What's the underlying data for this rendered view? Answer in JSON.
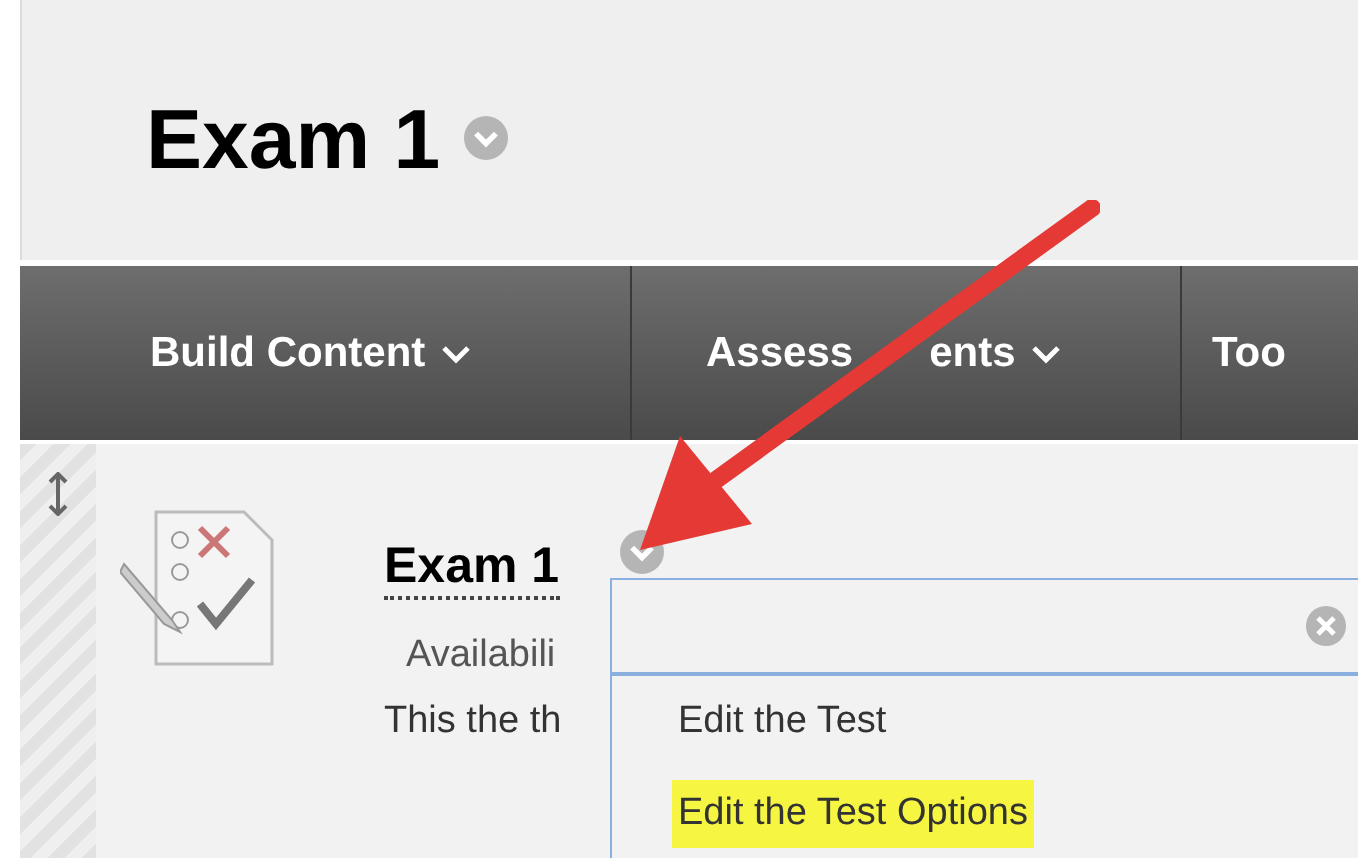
{
  "page_title": "Exam 1",
  "nav_items": [
    {
      "label": "Build Content",
      "has_menu": true
    },
    {
      "label": "Assess",
      "label_after_arrow": "ents",
      "has_menu": true
    },
    {
      "label": "Too",
      "has_menu": false
    }
  ],
  "content_item": {
    "title": "Exam 1",
    "availability": "Availabili",
    "description": "This the th"
  },
  "context_menu": {
    "items": [
      {
        "label": "Edit the Test",
        "highlighted": false
      },
      {
        "label": "Edit the Test Options",
        "highlighted": true
      }
    ]
  }
}
